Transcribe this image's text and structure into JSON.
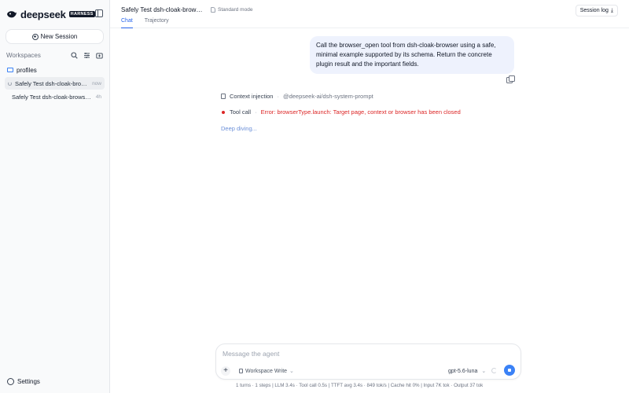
{
  "sidebar": {
    "brand": "deepseek",
    "badge": "HARNESS",
    "new_session_label": "New Session",
    "workspaces_label": "Workspaces",
    "folder": "profiles",
    "sessions": [
      {
        "title": "Safely Test dsh-cloak-browse…",
        "time": "now"
      },
      {
        "title": "Safely Test dsh-cloak-browser…",
        "time": "4h"
      }
    ],
    "settings_label": "Settings"
  },
  "header": {
    "title": "Safely Test dsh-cloak-browser…",
    "mode": "Standard mode",
    "tabs": [
      "Chat",
      "Trajectory"
    ],
    "session_log": "Session log"
  },
  "chat": {
    "user_message": "Call the browser_open tool from dsh-cloak-browser using a safe, minimal example supported by its schema. Return the concrete plugin result and the important fields.",
    "steps": [
      {
        "label": "Context injection",
        "detail": "@deepseek-ai/dsh-system-prompt"
      },
      {
        "label": "Tool call",
        "detail": "Error: browserType.launch: Target page, context or browser has been closed"
      }
    ],
    "status": "Deep diving..."
  },
  "composer": {
    "placeholder": "Message the agent",
    "workspace_mode": "Workspace Write",
    "model": "gpt-5.6-luna"
  },
  "stats": "1 turns · 1 steps   |   LLM 3.4s · Tool call 0.5s   |   TTFT avg 3.4s · 849 tok/s   |   Cache hit 0%   |   Input 7K tok · Output 37 tok"
}
